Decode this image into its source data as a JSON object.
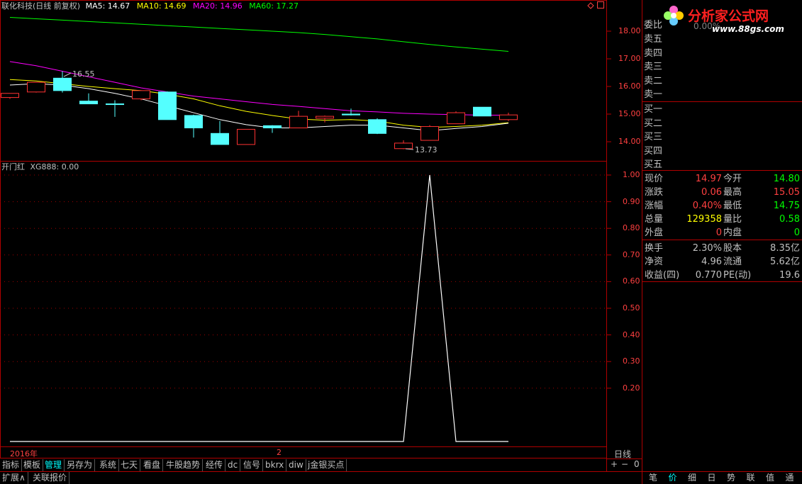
{
  "header": {
    "stock_name": "联化科技(日线 前复权)",
    "ma5": "MA5: 14.67",
    "ma10": "MA10: 14.69",
    "ma20": "MA20: 14.96",
    "ma60": "MA60: 17.27"
  },
  "indicator": {
    "name": "开门红",
    "value": "XG888: 0.00"
  },
  "annotations": {
    "high": "16.55",
    "low": "13.73"
  },
  "price_axis": [
    "18.00",
    "17.00",
    "16.00",
    "15.00",
    "14.00"
  ],
  "sub_axis": [
    "1.00",
    "0.90",
    "0.80",
    "0.70",
    "0.60",
    "0.50",
    "0.40",
    "0.30",
    "0.20"
  ],
  "time_axis": {
    "year": "2016年",
    "month": "2",
    "period": "日线"
  },
  "logo": {
    "text": "分析家公式网",
    "url": "www.88gs.com"
  },
  "orderbook": {
    "committee": "委比",
    "committee_value": "0.00%",
    "sell": [
      "卖五",
      "卖四",
      "卖三",
      "卖二",
      "卖一"
    ],
    "buy": [
      "买一",
      "买二",
      "买三",
      "买四",
      "买五"
    ]
  },
  "quote": [
    {
      "l1": "现价",
      "v1": "14.97",
      "l2": "今开",
      "v2": "14.80"
    },
    {
      "l1": "涨跌",
      "v1": "0.06",
      "l2": "最高",
      "v2": "15.05"
    },
    {
      "l1": "涨幅",
      "v1": "0.40%",
      "l2": "最低",
      "v2": "14.75"
    },
    {
      "l1": "总量",
      "v1": "129358",
      "l2": "量比",
      "v2": "0.58"
    },
    {
      "l1": "外盘",
      "v1": "0",
      "l2": "内盘",
      "v2": "0"
    },
    {
      "l1": "换手",
      "v1": "2.30%",
      "l2": "股本",
      "v2": "8.35亿"
    },
    {
      "l1": "净资",
      "v1": "4.96",
      "l2": "流通",
      "v2": "5.62亿"
    },
    {
      "l1": "收益(四)",
      "v1": "0.770",
      "l2": "PE(动)",
      "v2": "19.6"
    }
  ],
  "toolbar": [
    "指标",
    "模板",
    "管理",
    "另存为",
    "系统",
    "七天",
    "看盘",
    "牛股趋势",
    "经传",
    "dc",
    "信号",
    "bkrx",
    "diw",
    "j金银买点"
  ],
  "zoom": {
    "plus": "+",
    "minus": "−",
    "zero": "0"
  },
  "bottom_tabs": [
    "扩展∧",
    "关联报价"
  ],
  "right_tabs": [
    "笔",
    "价",
    "细",
    "日",
    "势",
    "联",
    "值",
    "通"
  ],
  "colors": {
    "up": "#ff3232",
    "down": "#54ffff",
    "ma5": "#ffffff",
    "ma10": "#ffff00",
    "ma20": "#ff00ff",
    "ma60": "#00ff00",
    "frame": "#b00000"
  },
  "candles": [
    {
      "o": 15.6,
      "h": 15.75,
      "l": 15.55,
      "c": 15.75
    },
    {
      "o": 15.8,
      "h": 16.15,
      "l": 15.78,
      "c": 16.15
    },
    {
      "o": 16.3,
      "h": 16.55,
      "l": 15.78,
      "c": 15.85
    },
    {
      "o": 15.47,
      "h": 15.75,
      "l": 15.4,
      "c": 15.37
    },
    {
      "o": 15.37,
      "h": 15.5,
      "l": 14.9,
      "c": 15.35
    },
    {
      "o": 15.55,
      "h": 15.85,
      "l": 15.5,
      "c": 15.85
    },
    {
      "o": 15.8,
      "h": 15.82,
      "l": 14.8,
      "c": 14.8
    },
    {
      "o": 14.95,
      "h": 14.98,
      "l": 14.15,
      "c": 14.5
    },
    {
      "o": 14.3,
      "h": 14.75,
      "l": 13.9,
      "c": 13.9
    },
    {
      "o": 13.9,
      "h": 14.45,
      "l": 13.9,
      "c": 14.45
    },
    {
      "o": 14.58,
      "h": 14.6,
      "l": 14.32,
      "c": 14.5
    },
    {
      "o": 14.5,
      "h": 15.12,
      "l": 14.5,
      "c": 14.92
    },
    {
      "o": 14.85,
      "h": 14.95,
      "l": 14.7,
      "c": 14.92
    },
    {
      "o": 15.0,
      "h": 15.2,
      "l": 14.95,
      "c": 14.97
    },
    {
      "o": 14.8,
      "h": 14.85,
      "l": 14.28,
      "c": 14.3
    },
    {
      "o": 13.75,
      "h": 14.05,
      "l": 13.73,
      "c": 13.95
    },
    {
      "o": 14.05,
      "h": 14.6,
      "l": 14.05,
      "c": 14.55
    },
    {
      "o": 14.65,
      "h": 15.1,
      "l": 14.65,
      "c": 15.05
    },
    {
      "o": 15.25,
      "h": 15.25,
      "l": 14.93,
      "c": 14.93
    },
    {
      "o": 14.8,
      "h": 15.05,
      "l": 14.75,
      "c": 14.97
    }
  ],
  "ma_series": {
    "ma5": [
      16.05,
      16.1,
      16.05,
      15.92,
      15.75,
      15.55,
      15.3,
      15.05,
      14.8,
      14.62,
      14.5,
      14.5,
      14.55,
      14.6,
      14.6,
      14.5,
      14.4,
      14.48,
      14.55,
      14.67
    ],
    "ma10": [
      16.25,
      16.2,
      16.1,
      16.0,
      15.92,
      15.85,
      15.72,
      15.55,
      15.3,
      15.1,
      14.95,
      14.82,
      14.78,
      14.8,
      14.75,
      14.6,
      14.52,
      14.55,
      14.6,
      14.69
    ],
    "ma20": [
      16.9,
      16.75,
      16.55,
      16.35,
      16.15,
      15.95,
      15.8,
      15.65,
      15.55,
      15.45,
      15.35,
      15.28,
      15.2,
      15.12,
      15.08,
      15.03,
      15.0,
      14.98,
      14.96,
      14.96
    ],
    "ma60": [
      18.5,
      18.45,
      18.4,
      18.35,
      18.3,
      18.25,
      18.2,
      18.15,
      18.1,
      18.05,
      18.0,
      17.95,
      17.88,
      17.8,
      17.72,
      17.62,
      17.52,
      17.43,
      17.35,
      17.27
    ]
  },
  "signal_series": [
    0,
    0,
    0,
    0,
    0,
    0,
    0,
    0,
    0,
    0,
    0,
    0,
    0,
    0,
    0,
    0,
    1,
    0,
    0,
    0
  ]
}
